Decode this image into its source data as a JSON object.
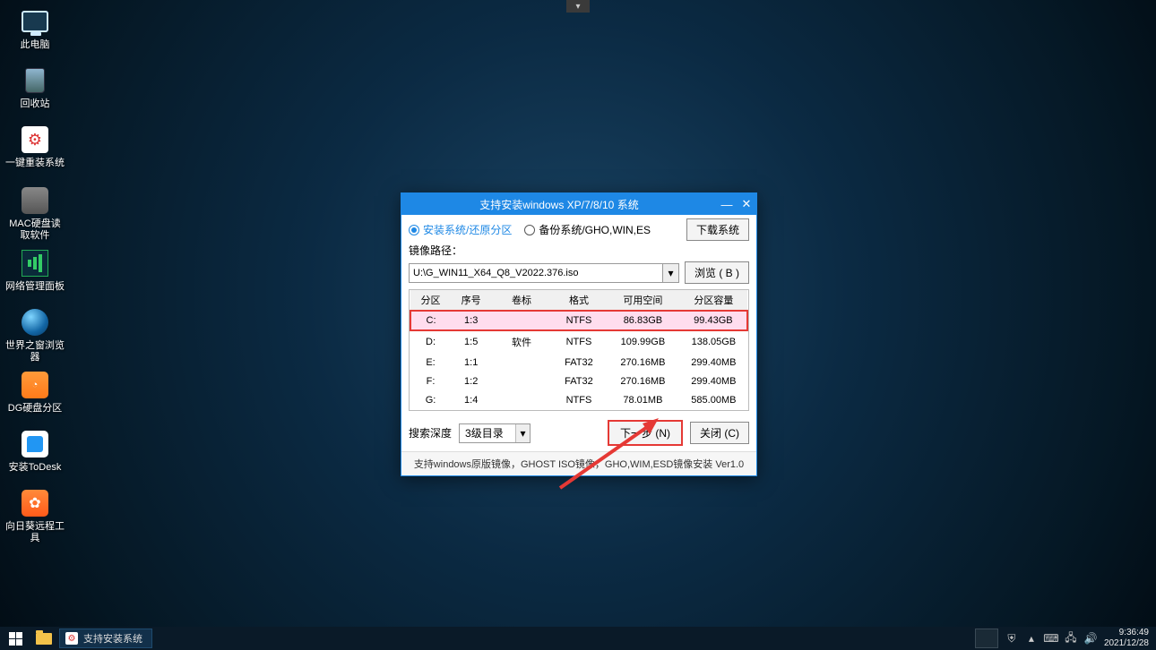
{
  "desktop_icons": {
    "pc": "此电脑",
    "bin": "回收站",
    "setup": "一键重装系统",
    "mac": "MAC硬盘读\n取软件",
    "net": "网络管理面板",
    "globe": "世界之窗浏览\n器",
    "dg": "DG硬盘分区",
    "todesk": "安装ToDesk",
    "sun": "向日葵远程工\n具"
  },
  "dialog": {
    "title": "支持安装windows XP/7/8/10 系统",
    "radio_install": "安装系统/还原分区",
    "radio_backup": "备份系统/GHO,WIN,ES",
    "download_btn": "下载系统",
    "image_path_label": "镜像路径：",
    "image_path_value": "U:\\G_WIN11_X64_Q8_V2022.376.iso",
    "browse_btn": "浏览 ( B )",
    "columns": {
      "partition": "分区",
      "seq": "序号",
      "volume": "卷标",
      "format": "格式",
      "free": "可用空间",
      "capacity": "分区容量"
    },
    "rows": [
      {
        "p": "C:",
        "s": "1:3",
        "v": "",
        "f": "NTFS",
        "free": "86.83GB",
        "cap": "99.43GB",
        "sel": true
      },
      {
        "p": "D:",
        "s": "1:5",
        "v": "软件",
        "f": "NTFS",
        "free": "109.99GB",
        "cap": "138.05GB",
        "sel": false
      },
      {
        "p": "E:",
        "s": "1:1",
        "v": "",
        "f": "FAT32",
        "free": "270.16MB",
        "cap": "299.40MB",
        "sel": false
      },
      {
        "p": "F:",
        "s": "1:2",
        "v": "",
        "f": "FAT32",
        "free": "270.16MB",
        "cap": "299.40MB",
        "sel": false
      },
      {
        "p": "G:",
        "s": "1:4",
        "v": "",
        "f": "NTFS",
        "free": "78.01MB",
        "cap": "585.00MB",
        "sel": false
      }
    ],
    "search_depth_label": "搜索深度",
    "search_depth_value": "3级目录",
    "next_btn": "下一步 (N)",
    "close_btn": "关闭 (C)",
    "footer_note": "支持windows原版镜像，GHOST ISO镜像，GHO,WIM,ESD镜像安装 Ver1.0"
  },
  "taskbar": {
    "running_app": "支持安装系统",
    "time": "9:36:49",
    "date": "2021/12/28"
  }
}
